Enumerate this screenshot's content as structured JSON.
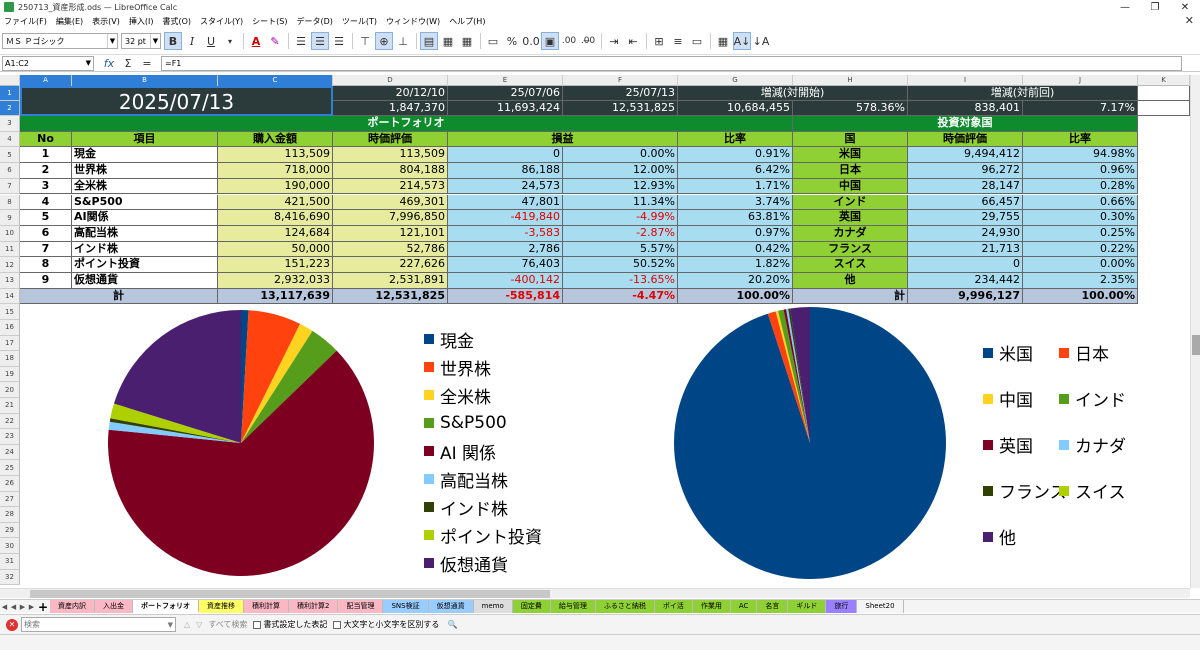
{
  "window": {
    "title": "250713_資産形成.ods — LibreOffice Calc",
    "minimize": "—",
    "maximize": "❐",
    "close": "✕"
  },
  "menu": [
    "ファイル(F)",
    "編集(E)",
    "表示(V)",
    "挿入(I)",
    "書式(O)",
    "スタイル(Y)",
    "シート(S)",
    "データ(D)",
    "ツール(T)",
    "ウィンドウ(W)",
    "ヘルプ(H)"
  ],
  "toolbar": {
    "font_name": "ＭＳ Ｐゴシック",
    "font_size": "32 pt",
    "bold": "B",
    "italic": "I",
    "underline": "U",
    "currency": "▭",
    "percent": "%",
    "decimals_add": ".00",
    "decimals_remove": ".0̶0"
  },
  "formula": {
    "cell_ref": "A1:C2",
    "fx": "fx",
    "sum": "Σ",
    "equals": "=",
    "content": "=F1"
  },
  "columns": [
    "A",
    "B",
    "C",
    "D",
    "E",
    "F",
    "G",
    "H",
    "I",
    "J",
    "K"
  ],
  "rows": [
    "1",
    "2",
    "3",
    "4",
    "5",
    "6",
    "7",
    "8",
    "9",
    "10",
    "11",
    "12",
    "13",
    "14",
    "15",
    "16",
    "17",
    "18",
    "19",
    "20",
    "21",
    "22",
    "23",
    "24",
    "25",
    "26",
    "27",
    "28",
    "29",
    "30",
    "31",
    "32"
  ],
  "header": {
    "date": "2025/07/13",
    "d1": "20/12/10",
    "e1": "25/07/06",
    "f1": "25/07/13",
    "g1": "増減(対開始)",
    "i1": "増減(対前回)",
    "d2": "1,847,370",
    "e2": "11,693,424",
    "f2": "12,531,825",
    "g2": "10,684,455",
    "h2": "578.36%",
    "i2": "838,401",
    "j2": "7.17%"
  },
  "portfolio": {
    "title": "ポートフォリオ",
    "country_title": "投資対象国",
    "cols": {
      "no": "No",
      "item": "項目",
      "cost": "購入金額",
      "value": "時価評価",
      "pl": "損益",
      "ratio": "比率",
      "country": "国",
      "cvalue": "時価評価",
      "cratio": "比率"
    },
    "rows": [
      {
        "no": "1",
        "item": "現金",
        "cost": "113,509",
        "value": "113,509",
        "pl": "0",
        "plp": "0.00%",
        "ratio": "0.91%",
        "country": "米国",
        "cvalue": "9,494,412",
        "cratio": "94.98%"
      },
      {
        "no": "2",
        "item": "世界株",
        "cost": "718,000",
        "value": "804,188",
        "pl": "86,188",
        "plp": "12.00%",
        "ratio": "6.42%",
        "country": "日本",
        "cvalue": "96,272",
        "cratio": "0.96%"
      },
      {
        "no": "3",
        "item": "全米株",
        "cost": "190,000",
        "value": "214,573",
        "pl": "24,573",
        "plp": "12.93%",
        "ratio": "1.71%",
        "country": "中国",
        "cvalue": "28,147",
        "cratio": "0.28%"
      },
      {
        "no": "4",
        "item": "S&P500",
        "cost": "421,500",
        "value": "469,301",
        "pl": "47,801",
        "plp": "11.34%",
        "ratio": "3.74%",
        "country": "インド",
        "cvalue": "66,457",
        "cratio": "0.66%"
      },
      {
        "no": "5",
        "item": "AI関係",
        "cost": "8,416,690",
        "value": "7,996,850",
        "pl": "-419,840",
        "plp": "-4.99%",
        "ratio": "63.81%",
        "country": "英国",
        "cvalue": "29,755",
        "cratio": "0.30%"
      },
      {
        "no": "6",
        "item": "高配当株",
        "cost": "124,684",
        "value": "121,101",
        "pl": "-3,583",
        "plp": "-2.87%",
        "ratio": "0.97%",
        "country": "カナダ",
        "cvalue": "24,930",
        "cratio": "0.25%"
      },
      {
        "no": "7",
        "item": "インド株",
        "cost": "50,000",
        "value": "52,786",
        "pl": "2,786",
        "plp": "5.57%",
        "ratio": "0.42%",
        "country": "フランス",
        "cvalue": "21,713",
        "cratio": "0.22%"
      },
      {
        "no": "8",
        "item": "ポイント投資",
        "cost": "151,223",
        "value": "227,626",
        "pl": "76,403",
        "plp": "50.52%",
        "ratio": "1.82%",
        "country": "スイス",
        "cvalue": "0",
        "cratio": "0.00%"
      },
      {
        "no": "9",
        "item": "仮想通貨",
        "cost": "2,932,033",
        "value": "2,531,891",
        "pl": "-400,142",
        "plp": "-13.65%",
        "ratio": "20.20%",
        "country": "他",
        "cvalue": "234,442",
        "cratio": "2.35%"
      }
    ],
    "total": {
      "label": "計",
      "cost": "13,117,639",
      "value": "12,531,825",
      "pl": "-585,814",
      "plp": "-4.47%",
      "ratio": "100.00%",
      "clabel": "計",
      "cvalue": "9,996,127",
      "cratio": "100.00%"
    }
  },
  "chart_data": [
    {
      "type": "pie",
      "categories": [
        "現金",
        "世界株",
        "全米株",
        "S&P500",
        "AI 関係",
        "高配当株",
        "インド株",
        "ポイント投資",
        "仮想通貨"
      ],
      "values": [
        113509,
        804188,
        214573,
        469301,
        7996850,
        121101,
        52786,
        227626,
        2531891
      ],
      "colors": [
        "#004586",
        "#ff420e",
        "#ffd320",
        "#579d1c",
        "#7e0021",
        "#83caff",
        "#314004",
        "#aecf00",
        "#4b1f6f"
      ],
      "legend": "right"
    },
    {
      "type": "pie",
      "categories": [
        "米国",
        "日本",
        "中国",
        "インド",
        "英国",
        "カナダ",
        "フランス",
        "スイス",
        "他"
      ],
      "values": [
        9494412,
        96272,
        28147,
        66457,
        29755,
        24930,
        21713,
        0,
        234442
      ],
      "colors": [
        "#004586",
        "#ff420e",
        "#ffd320",
        "#579d1c",
        "#7e0021",
        "#83caff",
        "#314004",
        "#aecf00",
        "#4b1f6f"
      ],
      "legend": "right"
    }
  ],
  "tabs": [
    "資産内訳",
    "入出金",
    "ポートフォリオ",
    "資産推移",
    "積利計算",
    "積利計算2",
    "配当管理",
    "SNS検証",
    "仮想通貨",
    "memo",
    "固定費",
    "給与管理",
    "ふるさと納税",
    "ポイ活",
    "作業用",
    "AC",
    "名言",
    "ギルド",
    "旅行",
    "Sheet20"
  ],
  "tab_colors": [
    "#f9b8c4",
    "#f9b8c4",
    "#ffffff",
    "#ffff66",
    "#f9b8c4",
    "#f9b8c4",
    "#f9b8c4",
    "#99ccff",
    "#99ccff",
    "#dddddd",
    "#8fd135",
    "#8fd135",
    "#8fd135",
    "#8fd135",
    "#8fd135",
    "#8fd135",
    "#8fd135",
    "#8fd135",
    "#9980ff",
    "#f4f4f4"
  ],
  "active_tab": "ポートフォリオ",
  "find": {
    "placeholder": "検索",
    "find_all": "すべて検索",
    "formatted": "書式設定した表記",
    "match_case": "大文字と小文字を区別する"
  }
}
